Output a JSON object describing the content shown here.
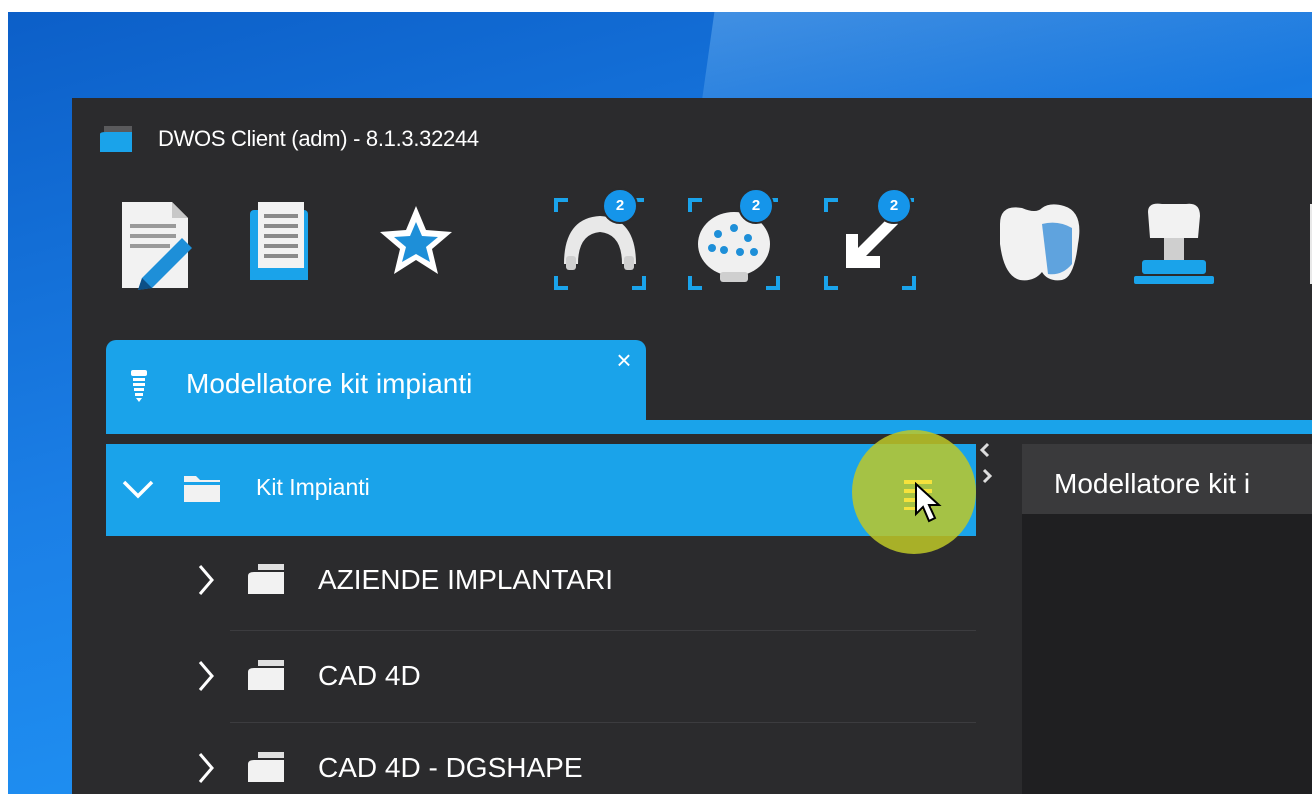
{
  "window": {
    "title": "DWOS Client (adm) - 8.1.3.32244"
  },
  "toolbar": {
    "items": [
      {
        "icon": "edit-order-icon"
      },
      {
        "icon": "order-list-icon"
      },
      {
        "icon": "favorites-star-icon"
      },
      {
        "icon": "scan-jaw-icon",
        "badge": "2"
      },
      {
        "icon": "scan-dots-icon",
        "badge": "2"
      },
      {
        "icon": "import-arrow-icon",
        "badge": "2"
      },
      {
        "icon": "crown-design-icon"
      },
      {
        "icon": "implant-abutment-icon"
      }
    ]
  },
  "tab": {
    "label": "Modellatore kit  impianti",
    "close": "×"
  },
  "tree": {
    "root": {
      "label": "Kit Impianti"
    },
    "items": [
      {
        "label": "AZIENDE IMPLANTARI"
      },
      {
        "label": "CAD 4D"
      },
      {
        "label": "CAD 4D - DGSHAPE"
      }
    ]
  },
  "right_panel": {
    "title": "Modellatore kit i"
  },
  "colors": {
    "accent": "#1aa3ea",
    "window_bg": "#2b2b2d",
    "highlight": "#bec828"
  }
}
